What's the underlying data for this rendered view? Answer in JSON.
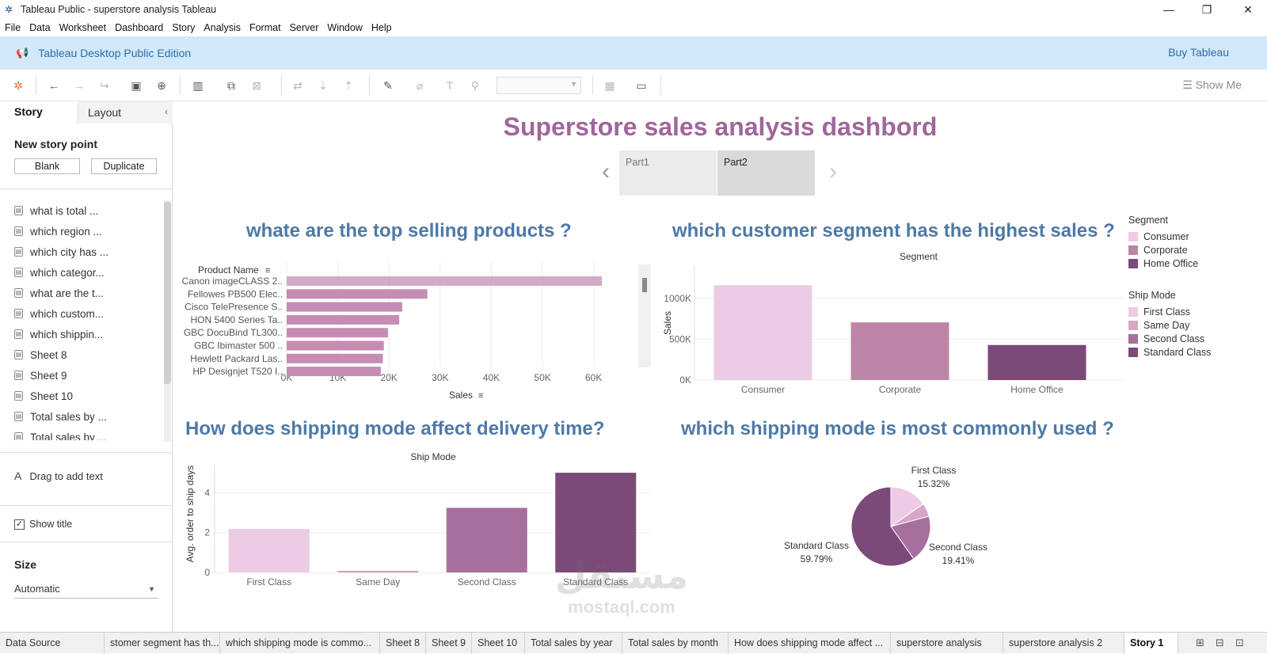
{
  "window": {
    "title": "Tableau Public - superstore analysis Tableau"
  },
  "menu": [
    "File",
    "Data",
    "Worksheet",
    "Dashboard",
    "Story",
    "Analysis",
    "Format",
    "Server",
    "Window",
    "Help"
  ],
  "banner": {
    "edition": "Tableau Desktop Public Edition",
    "buy": "Buy Tableau"
  },
  "toolbar": {
    "show_me": "Show Me"
  },
  "left_pane": {
    "tab_story": "Story",
    "tab_layout": "Layout",
    "new_story_point": "New story point",
    "blank": "Blank",
    "duplicate": "Duplicate",
    "sheets": [
      "what is total ...",
      "which region ...",
      "which city has ...",
      "which categor...",
      "what are the t...",
      "which custom...",
      "which shippin...",
      "Sheet 8",
      "Sheet 9",
      "Sheet 10",
      "Total sales by ...",
      "Total sales by ..."
    ],
    "drag_text": "Drag to add text",
    "show_title": "Show title",
    "size_label": "Size",
    "size_value": "Automatic"
  },
  "dashboard": {
    "title": "Superstore sales analysis dashbord",
    "story_points": [
      "Part1",
      "Part2"
    ],
    "q1": "whate are the top selling products ?",
    "q2": "which customer segment has the highest sales ?",
    "q3": "How does shipping mode affect delivery time?",
    "q4": "which shipping mode is most commonly used ?"
  },
  "chart_data": [
    {
      "type": "bar",
      "orientation": "horizontal",
      "ylabel": "Product Name",
      "xlabel": "Sales",
      "categories": [
        "Canon imageCLASS 2..",
        "Fellowes PB500 Elec..",
        "Cisco TelePresence S..",
        "HON 5400 Series Ta..",
        "GBC DocuBind TL300..",
        "GBC Ibimaster 500 ..",
        "Hewlett Packard Las..",
        "HP Designjet T520 I.."
      ],
      "values": [
        61600,
        27500,
        22600,
        22000,
        19800,
        19000,
        18800,
        18400
      ],
      "x_ticks": [
        "0K",
        "10K",
        "20K",
        "30K",
        "40K",
        "50K",
        "60K"
      ],
      "xlim": [
        0,
        65000
      ],
      "color": "#c58db3"
    },
    {
      "type": "bar",
      "title": "Segment",
      "ylabel": "Sales",
      "categories": [
        "Consumer",
        "Corporate",
        "Home Office"
      ],
      "values": [
        1161000,
        706000,
        429000
      ],
      "y_ticks": [
        "0K",
        "500K",
        "1000K"
      ],
      "ylim": [
        0,
        1250000
      ],
      "colors": [
        "#eecbe4",
        "#bd86a8",
        "#7b4a78"
      ]
    },
    {
      "type": "bar",
      "title": "Ship Mode",
      "ylabel": "Avg. order to ship days",
      "categories": [
        "First Class",
        "Same Day",
        "Second Class",
        "Standard Class"
      ],
      "values": [
        2.18,
        0.04,
        3.24,
        5.0
      ],
      "y_ticks": [
        "0",
        "2",
        "4"
      ],
      "ylim": [
        0,
        5.4
      ],
      "colors": [
        "#eecbe4",
        "#cf9fc0",
        "#a76f9e",
        "#7b4a78"
      ]
    },
    {
      "type": "pie",
      "slices": [
        {
          "label": "First Class",
          "pct_label": "15.32%",
          "value": 15.32,
          "color": "#eecbe4"
        },
        {
          "label": "Same Day",
          "pct_label": "",
          "value": 5.48,
          "color": "#d8a6c8"
        },
        {
          "label": "Second Class",
          "pct_label": "19.41%",
          "value": 19.41,
          "color": "#a76f9e"
        },
        {
          "label": "Standard Class",
          "pct_label": "59.79%",
          "value": 59.79,
          "color": "#7b4a78"
        }
      ]
    }
  ],
  "legends": {
    "segment_title": "Segment",
    "segment": [
      {
        "label": "Consumer",
        "color": "#eecbe4"
      },
      {
        "label": "Corporate",
        "color": "#bd86a8"
      },
      {
        "label": "Home Office",
        "color": "#7b4a78"
      }
    ],
    "shipmode_title": "Ship Mode",
    "shipmode": [
      {
        "label": "First Class",
        "color": "#eecbe4"
      },
      {
        "label": "Same Day",
        "color": "#d8a6c8"
      },
      {
        "label": "Second Class",
        "color": "#a76f9e"
      },
      {
        "label": "Standard Class",
        "color": "#7b4a78"
      }
    ]
  },
  "watermark": {
    "arabic": "مستقل",
    "latin": "mostaql.com"
  },
  "bottom_tabs": [
    "Data Source",
    "stomer segment has th...",
    "which shipping mode is commo...",
    "Sheet 8",
    "Sheet 9",
    "Sheet 10",
    "Total sales by year",
    "Total sales by month",
    "How does shipping mode affect ...",
    "superstore analysis",
    "superstore analysis 2",
    "Story 1"
  ]
}
